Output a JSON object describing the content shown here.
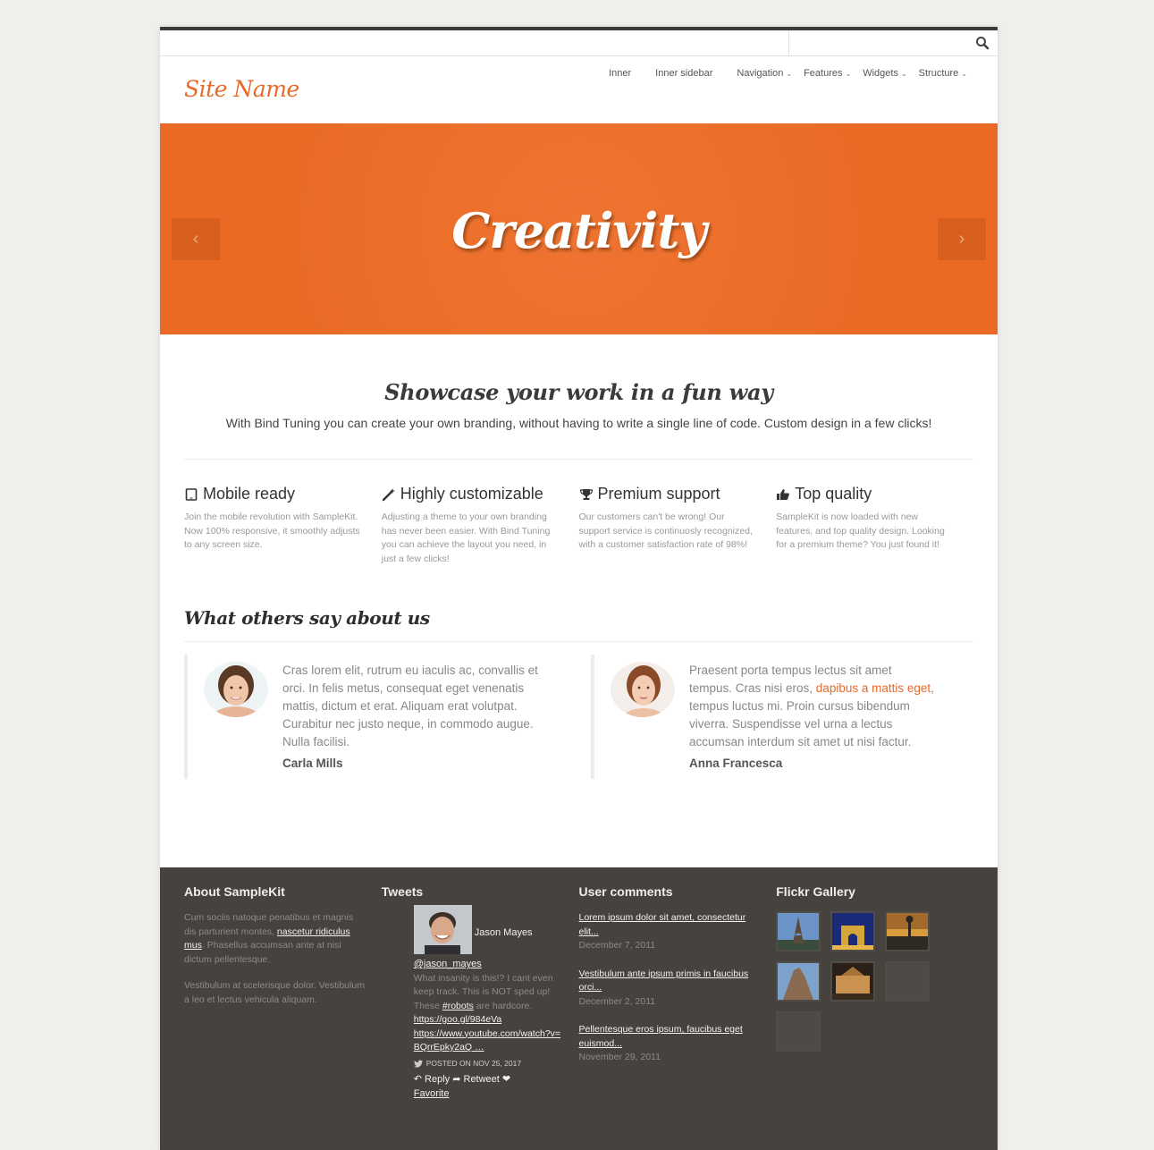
{
  "search": {
    "placeholder": ""
  },
  "site_name": "Site Name",
  "nav": [
    {
      "label": "Inner",
      "dropdown": false
    },
    {
      "label": "Inner sidebar",
      "dropdown": false
    },
    {
      "label": "Navigation",
      "dropdown": true
    },
    {
      "label": "Features",
      "dropdown": true
    },
    {
      "label": "Widgets",
      "dropdown": true
    },
    {
      "label": "Structure",
      "dropdown": true
    }
  ],
  "hero": {
    "title": "Creativity",
    "prev_icon": "chevron-left-icon",
    "next_icon": "chevron-right-icon",
    "color": "#ec6b27"
  },
  "intro": {
    "title": "Showcase your work in a fun way",
    "text": "With Bind Tuning you can create your own branding, without having to write a single line of code. Custom design in a few clicks!"
  },
  "features": [
    {
      "icon": "tablet-icon",
      "title": "Mobile ready",
      "text": "Join the mobile revolution with SampleKit. Now 100% responsive, it smoothly adjusts to any screen size."
    },
    {
      "icon": "magic-wand-icon",
      "title": "Highly customizable",
      "text": "Adjusting a theme to your own branding has never been easier. With Bind Tuning you can achieve the layout you need, in just a few clicks!"
    },
    {
      "icon": "trophy-icon",
      "title": "Premium support",
      "text": "Our customers can't be wrong! Our support service is continuosly recognized, with a customer satisfaction rate of 98%!"
    },
    {
      "icon": "thumbs-up-icon",
      "title": "Top quality",
      "text": "SampleKit is now loaded with new features, and top quality design. Looking for a premium theme? You just found it!"
    }
  ],
  "testimonials_title": "What others say about us",
  "testimonials": [
    {
      "quote": "Cras lorem elit, rutrum eu iaculis ac, convallis et orci. In felis metus, consequat eget venenatis mattis, dictum et erat. Aliquam erat volutpat. Curabitur nec justo neque, in commodo augue. Nulla facilisi.",
      "author": "Carla Mills"
    },
    {
      "quote_before": "Praesent porta tempus lectus sit amet tempus. Cras nisi eros, ",
      "quote_link": "dapibus a mattis eget",
      "quote_after": ", tempus luctus mi. Proin cursus bibendum viverra. Suspendisse vel urna a lectus accumsan interdum sit amet ut nisi factur.",
      "author": "Anna Francesca"
    }
  ],
  "footer": {
    "about": {
      "title": "About SampleKit",
      "p1_before": "Cum sociis natoque penatibus et magnis dis parturient montes, ",
      "p1_link": "nascetur ridiculus mus",
      "p1_after": ". Phasellus accumsan ante at nisi dictum pellentesque.",
      "p2": "Vestibulum at scelerisque dolor. Vestibulum a leo et lectus vehicula aliquam."
    },
    "tweets": {
      "title": "Tweets",
      "name": "Jason Mayes",
      "handle": "@jason_mayes",
      "body_before": "What insanity is this!? I cant even keep track. This is NOT sped up! These ",
      "body_link": "#robots",
      "body_after": " are hardcore.",
      "link1": "https://goo.gl/984eVa",
      "link2": "https://www.youtube.com/watch?v=BQrrEpky2aQ …",
      "posted": "POSTED ON NOV 25, 2017",
      "reply": "Reply",
      "retweet": "Retweet",
      "favorite": "Favorite"
    },
    "comments": {
      "title": "User comments",
      "items": [
        {
          "title": "Lorem ipsum dolor sit amet, consectetur elit...",
          "date": "December 7, 2011"
        },
        {
          "title": "Vestibulum ante ipsum primis in faucibus orci...",
          "date": "December 2, 2011"
        },
        {
          "title": "Pellentesque eros ipsum, faucibus eget euismod...",
          "date": "November 29, 2011"
        }
      ]
    },
    "gallery": {
      "title": "Flickr Gallery"
    }
  }
}
